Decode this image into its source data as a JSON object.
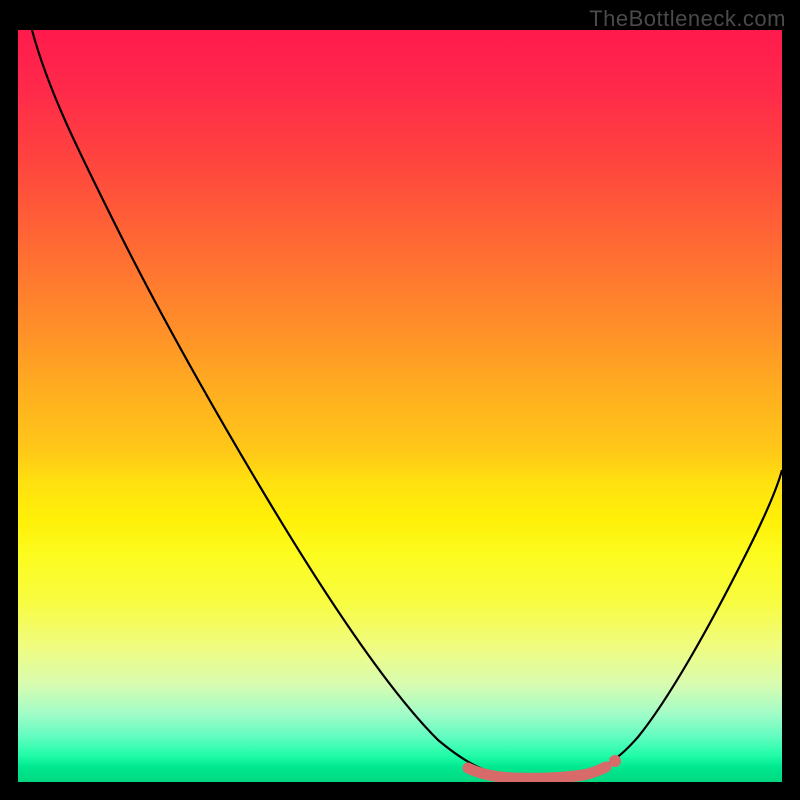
{
  "watermark": "TheBottleneck.com",
  "chart_data": {
    "type": "line",
    "title": "",
    "xlabel": "",
    "ylabel": "",
    "x_range": [
      0,
      100
    ],
    "y_range": [
      0,
      100
    ],
    "background": "heatmap-gradient",
    "gradient_stops": [
      {
        "pos": 0,
        "color": "#ff1a4d"
      },
      {
        "pos": 50,
        "color": "#ffc818"
      },
      {
        "pos": 75,
        "color": "#f8fc40"
      },
      {
        "pos": 100,
        "color": "#00d880"
      }
    ],
    "series": [
      {
        "name": "bottleneck-curve",
        "points": [
          {
            "x": 2,
            "y": 100
          },
          {
            "x": 8,
            "y": 92
          },
          {
            "x": 15,
            "y": 80
          },
          {
            "x": 25,
            "y": 62
          },
          {
            "x": 35,
            "y": 44
          },
          {
            "x": 45,
            "y": 26
          },
          {
            "x": 53,
            "y": 12
          },
          {
            "x": 58,
            "y": 5
          },
          {
            "x": 62,
            "y": 1.5
          },
          {
            "x": 66,
            "y": 0.5
          },
          {
            "x": 70,
            "y": 0.5
          },
          {
            "x": 74,
            "y": 1
          },
          {
            "x": 77,
            "y": 2.5
          },
          {
            "x": 82,
            "y": 9
          },
          {
            "x": 88,
            "y": 20
          },
          {
            "x": 94,
            "y": 33
          },
          {
            "x": 100,
            "y": 48
          }
        ]
      }
    ],
    "highlight_region": {
      "x_start": 59,
      "x_end": 77,
      "description": "optimal-zone-marker"
    }
  }
}
